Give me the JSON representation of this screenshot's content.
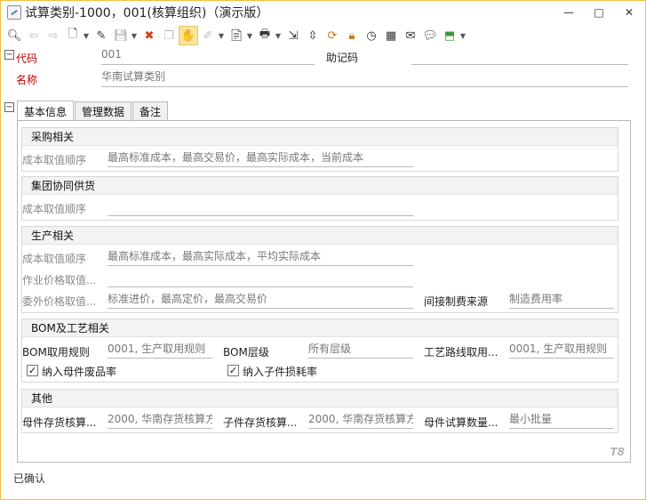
{
  "window": {
    "title": "试算类别-1000，001(核算组织)（演示版）",
    "minimize_icon": "minimize-icon",
    "maximize_icon": "maximize-icon",
    "close_icon": "close-icon"
  },
  "toolbar": {
    "items": [
      {
        "name": "preview-icon",
        "glyph": "🔍︎"
      },
      {
        "name": "back-arrow-icon",
        "glyph": "⇦",
        "disabled": true
      },
      {
        "name": "forward-arrow-icon",
        "glyph": "⇨",
        "disabled": true
      },
      {
        "name": "new-document-icon",
        "glyph": "🗋"
      },
      {
        "name": "edit-icon",
        "glyph": "✎"
      },
      {
        "name": "save-icon",
        "glyph": "💾︎",
        "disabled": true
      },
      {
        "name": "delete-icon",
        "glyph": "✖"
      },
      {
        "name": "copy-icon",
        "glyph": "❐",
        "disabled": true
      },
      {
        "name": "audit-icon",
        "glyph": "✋"
      },
      {
        "name": "unaudit-icon",
        "glyph": "✐",
        "disabled": true
      },
      {
        "name": "import-icon",
        "glyph": "📄︎"
      },
      {
        "name": "print-icon",
        "glyph": "🖶"
      },
      {
        "name": "link-query-icon",
        "glyph": "⇲"
      },
      {
        "name": "push-down-icon",
        "glyph": "⇳"
      },
      {
        "name": "refresh-icon",
        "glyph": "⟳"
      },
      {
        "name": "lock-icon",
        "glyph": "🔒︎"
      },
      {
        "name": "history-icon",
        "glyph": "◷"
      },
      {
        "name": "calculator-icon",
        "glyph": "▦"
      },
      {
        "name": "mail-icon",
        "glyph": "✉"
      },
      {
        "name": "message-icon",
        "glyph": "💬︎"
      },
      {
        "name": "export-icon",
        "glyph": "⬒"
      }
    ]
  },
  "header": {
    "code_label": "代码",
    "code_value": "001",
    "mnemonic_label": "助记码",
    "mnemonic_value": "",
    "name_label": "名称",
    "name_value": "华南试算类别"
  },
  "tabs": [
    {
      "label": "基本信息",
      "active": true
    },
    {
      "label": "管理数据",
      "active": false
    },
    {
      "label": "备注",
      "active": false
    }
  ],
  "groups": {
    "purchase": {
      "title": "采购相关",
      "cost_order_label": "成本取值顺序",
      "cost_order_value": "最高标准成本，最高交易价，最高实际成本，当前成本"
    },
    "group_supply": {
      "title": "集团协同供货",
      "cost_order_label": "成本取值顺序",
      "cost_order_value": ""
    },
    "production": {
      "title": "生产相关",
      "cost_order_label": "成本取值顺序",
      "cost_order_value": "最高标准成本，最高实际成本，平均实际成本",
      "operation_price_label": "作业价格取值...",
      "operation_price_value": "",
      "outsource_price_label": "委外价格取值...",
      "outsource_price_value": "标准进价，最高定价，最高交易价",
      "indirect_cost_label": "间接制费来源",
      "indirect_cost_value": "制造费用率"
    },
    "bom": {
      "title": "BOM及工艺相关",
      "bom_rule_label": "BOM取用规则",
      "bom_rule_value": "0001, 生产取用规则",
      "bom_level_label": "BOM层级",
      "bom_level_value": "所有层级",
      "route_label": "工艺路线取用...",
      "route_value": "0001, 生产取用规则",
      "parent_scrap_label": "纳入母件废品率",
      "parent_scrap_checked": true,
      "child_loss_label": "纳入子件损耗率",
      "child_loss_checked": true
    },
    "other": {
      "title": "其他",
      "parent_inv_label": "母件存货核算...",
      "parent_inv_value": "2000, 华南存货核算方",
      "child_inv_label": "子件存货核算...",
      "child_inv_value": "2000, 华南存货核算方",
      "parent_qty_label": "母件试算数量...",
      "parent_qty_value": "最小批量"
    }
  },
  "watermark": "T8",
  "status_text": "已确认"
}
